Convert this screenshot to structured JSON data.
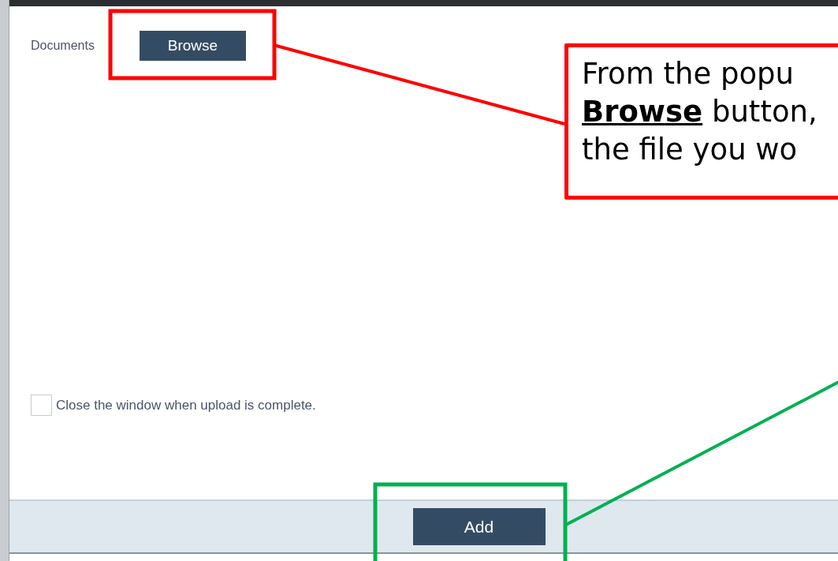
{
  "dialog": {
    "documents_label": "Documents",
    "browse_button": "Browse",
    "checkbox": {
      "label": "Close the window when upload is complete.",
      "checked": false
    },
    "add_button": "Add"
  },
  "callout": {
    "lines": [
      {
        "text": "From the popu"
      },
      {
        "emphasis": "Browse",
        "text": " button,"
      },
      {
        "text": "the file you wo"
      }
    ]
  }
}
